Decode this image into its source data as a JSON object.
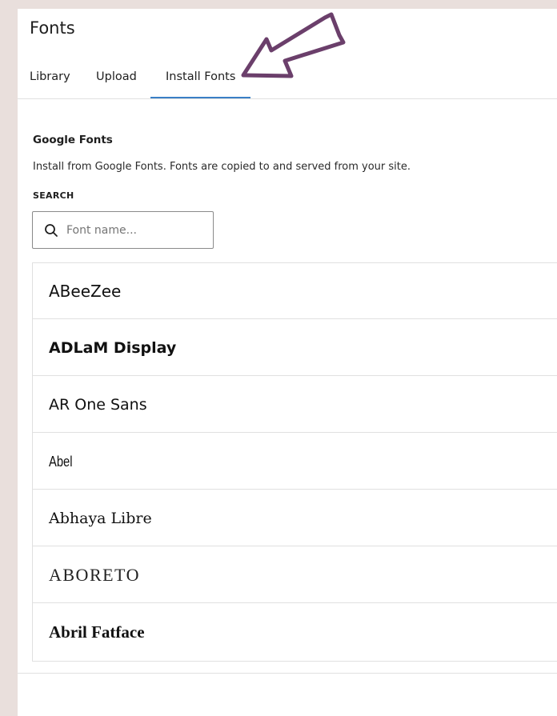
{
  "panel": {
    "title": "Fonts"
  },
  "tabs": [
    {
      "label": "Library",
      "active": false
    },
    {
      "label": "Upload",
      "active": false
    },
    {
      "label": "Install Fonts",
      "active": true
    }
  ],
  "section": {
    "title": "Google Fonts",
    "description": "Install from Google Fonts. Fonts are copied to and served from your site."
  },
  "search": {
    "label": "SEARCH",
    "placeholder": "Font name...",
    "value": "",
    "icon": "search-icon"
  },
  "fonts": [
    {
      "name": "ABeeZee"
    },
    {
      "name": "ADLaM Display"
    },
    {
      "name": "AR One Sans"
    },
    {
      "name": "Abel"
    },
    {
      "name": "Abhaya Libre"
    },
    {
      "name": "ABORETO"
    },
    {
      "name": "Abril Fatface"
    }
  ],
  "colors": {
    "accent": "#3a7fc6",
    "annotation_arrow": "#6b3f6b",
    "backdrop": "#e9dfdc"
  }
}
